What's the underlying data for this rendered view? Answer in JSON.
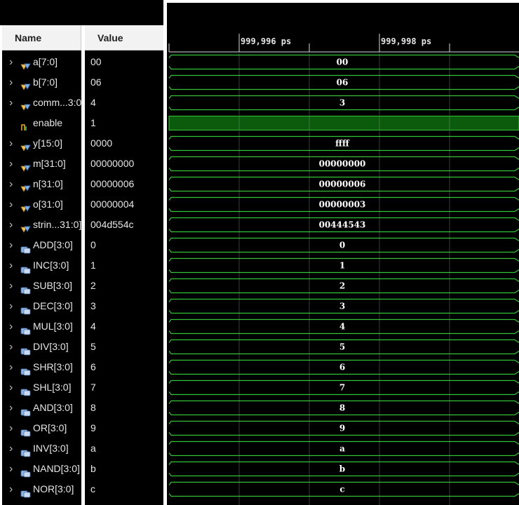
{
  "columns": {
    "name": "Name",
    "value": "Value"
  },
  "timeline": {
    "markers": [
      "999,996 ps",
      "999,998 ps"
    ]
  },
  "colors": {
    "waveform": "#35c235",
    "bit_high_fill": "#0c5a0c",
    "background": "#000000"
  },
  "signals": [
    {
      "name": "a[7:0]",
      "value": "00",
      "wave": "00",
      "kind": "bus",
      "icon": "bus-signal-icon",
      "expandable": true
    },
    {
      "name": "b[7:0]",
      "value": "06",
      "wave": "06",
      "kind": "bus",
      "icon": "bus-signal-icon",
      "expandable": true
    },
    {
      "name": "comm...3:0",
      "value": "4",
      "wave": "3",
      "kind": "bus",
      "icon": "bus-signal-icon",
      "expandable": true
    },
    {
      "name": "enable",
      "value": "1",
      "wave": "",
      "kind": "bit",
      "icon": "bit-signal-icon",
      "expandable": false
    },
    {
      "name": "y[15:0]",
      "value": "0000",
      "wave": "ffff",
      "kind": "bus",
      "icon": "bus-signal-icon",
      "expandable": true
    },
    {
      "name": "m[31:0]",
      "value": "00000000",
      "wave": "00000000",
      "kind": "bus",
      "icon": "bus-signal-icon",
      "expandable": true
    },
    {
      "name": "n[31:0]",
      "value": "00000006",
      "wave": "00000006",
      "kind": "bus",
      "icon": "bus-signal-icon",
      "expandable": true
    },
    {
      "name": "o[31:0]",
      "value": "00000004",
      "wave": "00000003",
      "kind": "bus",
      "icon": "bus-signal-icon",
      "expandable": true
    },
    {
      "name": "strin...31:0]",
      "value": "004d554c",
      "wave": "00444543",
      "kind": "bus",
      "icon": "bus-signal-icon",
      "expandable": true
    },
    {
      "name": "ADD[3:0]",
      "value": "0",
      "wave": "0",
      "kind": "bus",
      "icon": "parameter-icon",
      "expandable": true
    },
    {
      "name": "INC[3:0]",
      "value": "1",
      "wave": "1",
      "kind": "bus",
      "icon": "parameter-icon",
      "expandable": true
    },
    {
      "name": "SUB[3:0]",
      "value": "2",
      "wave": "2",
      "kind": "bus",
      "icon": "parameter-icon",
      "expandable": true
    },
    {
      "name": "DEC[3:0]",
      "value": "3",
      "wave": "3",
      "kind": "bus",
      "icon": "parameter-icon",
      "expandable": true
    },
    {
      "name": "MUL[3:0]",
      "value": "4",
      "wave": "4",
      "kind": "bus",
      "icon": "parameter-icon",
      "expandable": true
    },
    {
      "name": "DIV[3:0]",
      "value": "5",
      "wave": "5",
      "kind": "bus",
      "icon": "parameter-icon",
      "expandable": true
    },
    {
      "name": "SHR[3:0]",
      "value": "6",
      "wave": "6",
      "kind": "bus",
      "icon": "parameter-icon",
      "expandable": true
    },
    {
      "name": "SHL[3:0]",
      "value": "7",
      "wave": "7",
      "kind": "bus",
      "icon": "parameter-icon",
      "expandable": true
    },
    {
      "name": "AND[3:0]",
      "value": "8",
      "wave": "8",
      "kind": "bus",
      "icon": "parameter-icon",
      "expandable": true
    },
    {
      "name": "OR[3:0]",
      "value": "9",
      "wave": "9",
      "kind": "bus",
      "icon": "parameter-icon",
      "expandable": true
    },
    {
      "name": "INV[3:0]",
      "value": "a",
      "wave": "a",
      "kind": "bus",
      "icon": "parameter-icon",
      "expandable": true
    },
    {
      "name": "NAND[3:0]",
      "value": "b",
      "wave": "b",
      "kind": "bus",
      "icon": "parameter-icon",
      "expandable": true
    },
    {
      "name": "NOR[3:0]",
      "value": "c",
      "wave": "c",
      "kind": "bus",
      "icon": "parameter-icon",
      "expandable": true
    }
  ]
}
